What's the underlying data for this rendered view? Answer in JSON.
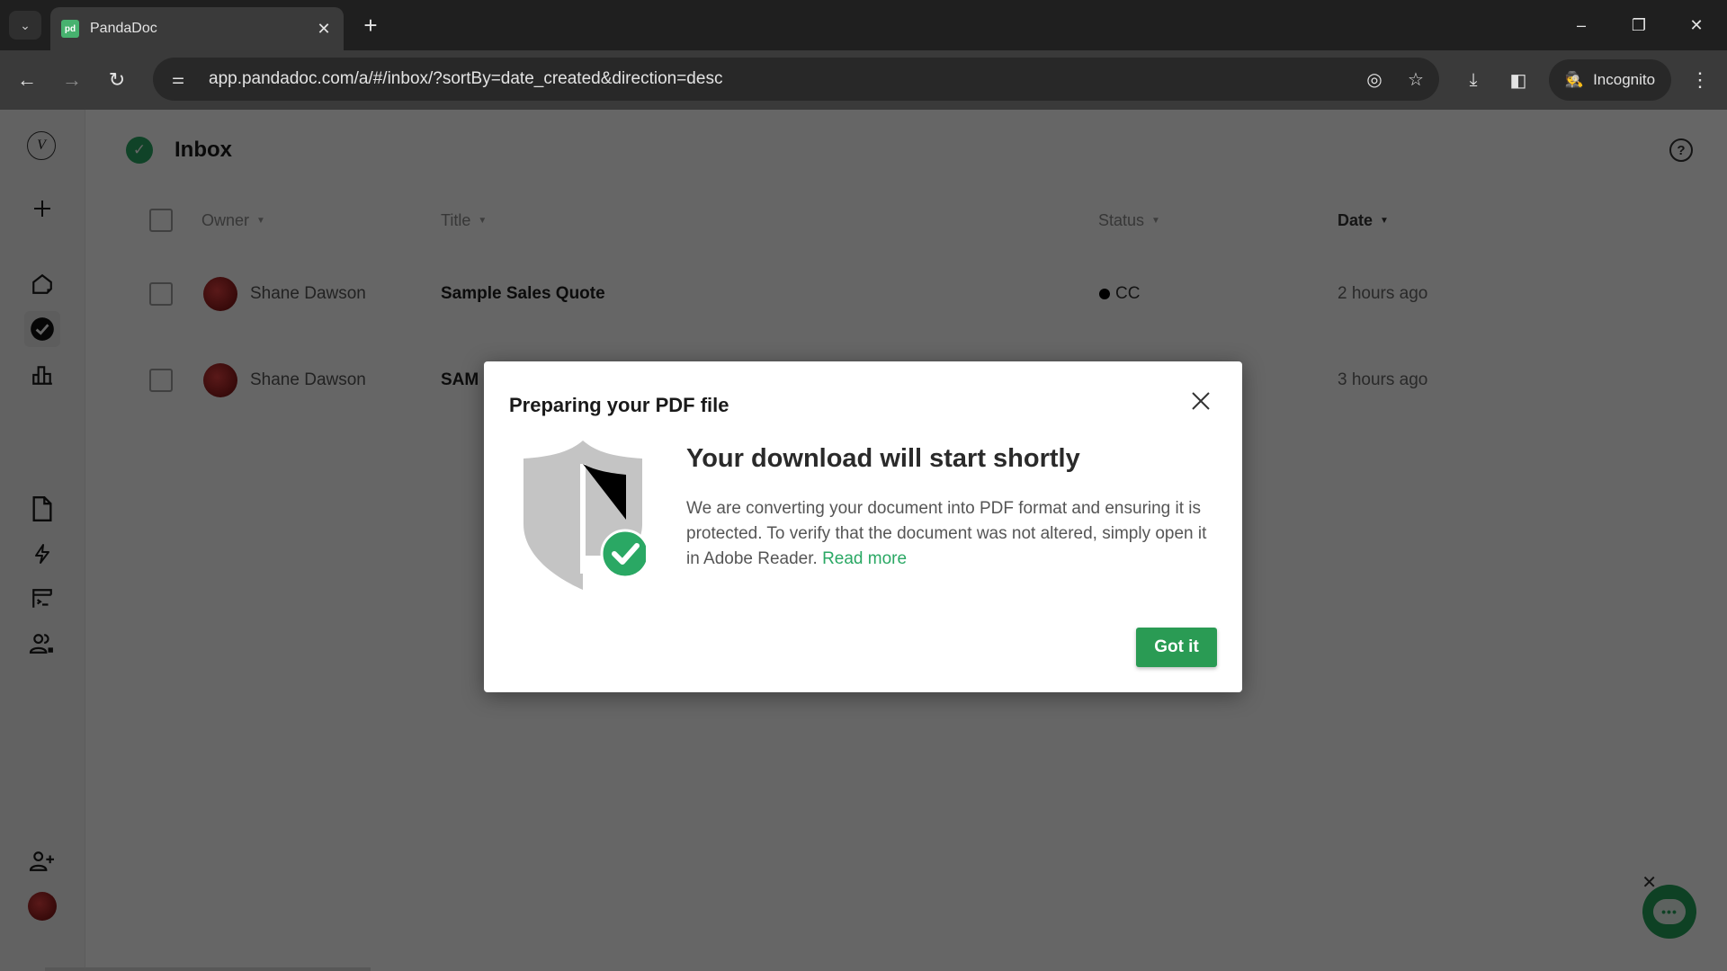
{
  "browser": {
    "tab_title": "PandaDoc",
    "tab_favicon": "pd",
    "url": "app.pandadoc.com/a/#/inbox/?sortBy=date_created&direction=desc",
    "incognito_label": "Incognito",
    "icons": {
      "tab_search": "chevron-down-icon",
      "close_tab": "close-icon",
      "new_tab": "plus-icon",
      "minimize": "minimize-icon",
      "restore": "restore-icon",
      "close_window": "close-icon",
      "back": "arrow-left-icon",
      "forward": "arrow-right-icon",
      "reload": "reload-icon",
      "site_info": "tune-icon",
      "tracking": "eye-off-icon",
      "bookmark": "star-icon",
      "downloads": "download-icon",
      "side_panel": "side-panel-icon",
      "menu": "kebab-menu-icon"
    }
  },
  "sidebar": {
    "items": [
      {
        "name": "workspace-logo",
        "label": "V"
      },
      {
        "name": "create",
        "icon": "plus-icon"
      },
      {
        "name": "home",
        "icon": "home-icon"
      },
      {
        "name": "inbox",
        "icon": "check-circle-icon",
        "active": true
      },
      {
        "name": "reports",
        "icon": "bar-chart-icon"
      },
      {
        "name": "documents",
        "icon": "document-icon"
      },
      {
        "name": "automation",
        "icon": "lightning-icon"
      },
      {
        "name": "templates",
        "icon": "template-icon"
      },
      {
        "name": "contacts",
        "icon": "users-icon"
      },
      {
        "name": "invite",
        "icon": "add-user-icon"
      },
      {
        "name": "profile",
        "icon": "avatar-icon"
      }
    ]
  },
  "page": {
    "title": "Inbox",
    "help_glyph": "?"
  },
  "table": {
    "columns": {
      "owner": "Owner",
      "title": "Title",
      "status": "Status",
      "date": "Date"
    },
    "rows": [
      {
        "owner": "Shane Dawson",
        "title": "Sample Sales Quote",
        "status": "CC",
        "date": "2 hours ago"
      },
      {
        "owner": "Shane Dawson",
        "title": "SAM",
        "status": "",
        "date": "3 hours ago"
      }
    ]
  },
  "dialog": {
    "title": "Preparing your PDF file",
    "heading": "Your download will start shortly",
    "body": "We are converting your document into PDF format and ensuring it is protected. To verify that the document was not altered, simply open it in Adobe Reader.",
    "link": "Read more",
    "button": "Got it"
  },
  "colors": {
    "brand_green": "#2a9b54",
    "link_green": "#2aa864"
  }
}
